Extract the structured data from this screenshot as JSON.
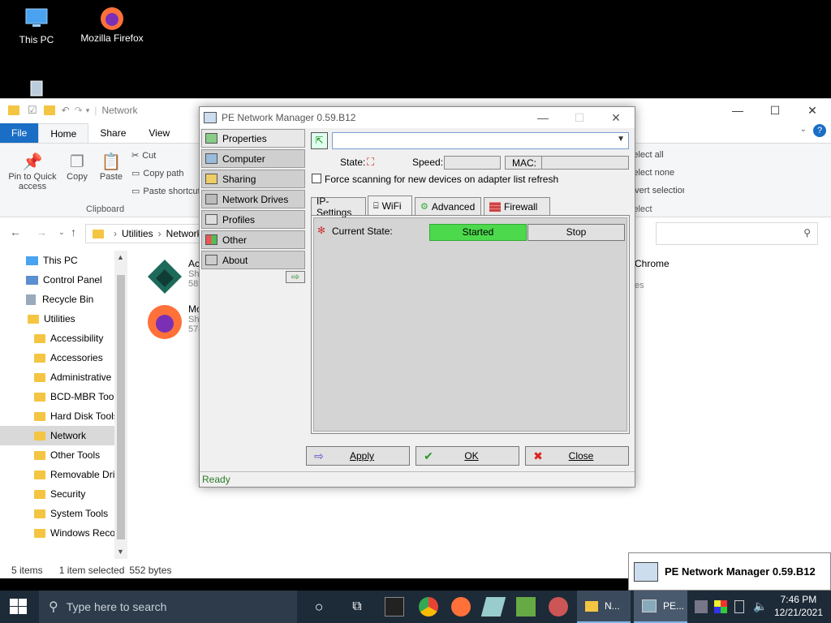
{
  "desktop": {
    "icons": [
      {
        "label": "This PC"
      },
      {
        "label": "Mozilla Firefox"
      }
    ]
  },
  "explorer": {
    "title": "Network",
    "tabs": [
      "File",
      "Home",
      "Share",
      "View"
    ],
    "ribbon": {
      "pin_label": "Pin to Quick access",
      "copy_label": "Copy",
      "paste_label": "Paste",
      "cut_label": "Cut",
      "copy_path_label": "Copy path",
      "paste_shortcut_label": "Paste shortcut",
      "group_clipboard": "Clipboard",
      "select_all": "Select all",
      "select_none": "Select none",
      "invert_selection": "Invert selection",
      "group_select": "Select"
    },
    "address": {
      "part1": "Utilities",
      "part2": "Network"
    },
    "nav_items": [
      {
        "label": "This PC"
      },
      {
        "label": "Control Panel"
      },
      {
        "label": "Recycle Bin"
      },
      {
        "label": "Utilities"
      },
      {
        "label": "Accessibility"
      },
      {
        "label": "Accessories"
      },
      {
        "label": "Administrative"
      },
      {
        "label": "BCD-MBR Tool"
      },
      {
        "label": "Hard Disk Tools"
      },
      {
        "label": "Network"
      },
      {
        "label": "Other Tools"
      },
      {
        "label": "Removable Dri"
      },
      {
        "label": "Security"
      },
      {
        "label": "System Tools"
      },
      {
        "label": "Windows Reco"
      }
    ],
    "files": [
      {
        "name": "Ac",
        "sub1": "Sh",
        "sub2": "589"
      },
      {
        "name": "Mo",
        "sub1": "Sh",
        "sub2": "574"
      },
      {
        "name": "Chrome",
        "sub1": "",
        "sub2": "es"
      }
    ],
    "status": {
      "items": "5 items",
      "selected": "1 item selected",
      "size": "552 bytes"
    }
  },
  "pe_dialog": {
    "title": "PE Network Manager 0.59.B12",
    "sidebar": [
      {
        "label": "Properties"
      },
      {
        "label": "Computer"
      },
      {
        "label": "Sharing"
      },
      {
        "label": "Network Drives"
      },
      {
        "label": "Profiles"
      },
      {
        "label": "Other"
      },
      {
        "label": "About"
      }
    ],
    "adapter_value": "",
    "state_label": "State:",
    "speed_label": "Speed:",
    "mac_label": "MAC:",
    "force_scan_label": "Force scanning for new devices on adapter list refresh",
    "tabs": [
      {
        "label": "IP-Settings"
      },
      {
        "label": "WiFi"
      },
      {
        "label": "Advanced"
      },
      {
        "label": "Firewall"
      }
    ],
    "current_state_label": "Current State:",
    "started_label": "Started",
    "stop_label": "Stop",
    "apply_label": "Apply",
    "ok_label": "OK",
    "close_label": "Close",
    "status": "Ready",
    "colors": {
      "started_bg": "#4cd94c"
    }
  },
  "taskbar": {
    "search_placeholder": "Type here to search",
    "app1_label": "N...",
    "app2_label": "PE...",
    "time": "7:46 PM",
    "date": "12/21/2021"
  },
  "tray_tooltip": "PE Network Manager 0.59.B12"
}
